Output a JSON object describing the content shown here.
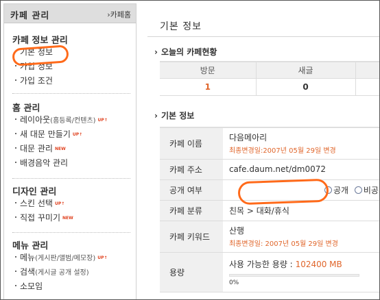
{
  "sidebar": {
    "title": "카페 관리",
    "home_link": "›카페홈",
    "sections": [
      {
        "title": "카페 정보 관리",
        "items": [
          {
            "label": "기본 정보",
            "selected": true
          },
          {
            "label": "가입 정보"
          },
          {
            "label": "가입 조건"
          }
        ]
      },
      {
        "title": "홈 관리",
        "items": [
          {
            "label": "레이아웃",
            "sub": "(홈등록/컨텐츠)",
            "tag": "UP↑"
          },
          {
            "label": "새 대문 만들기",
            "tag": "UP↑"
          },
          {
            "label": "대문 관리",
            "tag": "NEW"
          },
          {
            "label": "배경음악 관리"
          }
        ]
      },
      {
        "title": "디자인 관리",
        "items": [
          {
            "label": "스킨 선택",
            "tag": "UP↑"
          },
          {
            "label": "직접 꾸미기",
            "tag": "NEW"
          }
        ]
      },
      {
        "title": "메뉴 관리",
        "items": [
          {
            "label": "메뉴",
            "sub": "(게시판/앨범/메모장)",
            "tag": "UP↑"
          },
          {
            "label": "검색",
            "sub": "(게시글 공개 설정)"
          },
          {
            "label": "소모임"
          }
        ]
      }
    ]
  },
  "main": {
    "title": "기본 정보",
    "today": {
      "heading": "오늘의 카페현황",
      "headers": [
        "방문",
        "새글",
        ""
      ],
      "values": [
        "1",
        "0",
        ""
      ]
    },
    "info": {
      "heading": "기본 정보",
      "rows": {
        "name": {
          "label": "카페 이름",
          "value": "다음메아리",
          "changed": "최종변경일:2007년 05월 29일 변경"
        },
        "url": {
          "label": "카페 주소",
          "value": "cafe.daum.net/dm0072"
        },
        "public": {
          "label": "공개 여부",
          "option_public": "공개",
          "option_private": "비공개"
        },
        "category": {
          "label": "카페 분류",
          "value": "친목 > 대화/휴식"
        },
        "keyword": {
          "label": "카페 키워드",
          "value": "산행",
          "changed": "최종변경일: 2007년 05월 29일 변경"
        },
        "capacity": {
          "label": "용량",
          "available_label": "사용 가능한 용량 :",
          "available_value": "102400 MB",
          "percent": "0%",
          "used_fraction": 0
        }
      }
    }
  },
  "colors": {
    "accent": "#e0652a",
    "highlight": "#ff6a1a"
  },
  "icons": {
    "section_arrow": "chevron-right-icon",
    "radio": "radio-icon",
    "bullet": "bullet-icon"
  }
}
